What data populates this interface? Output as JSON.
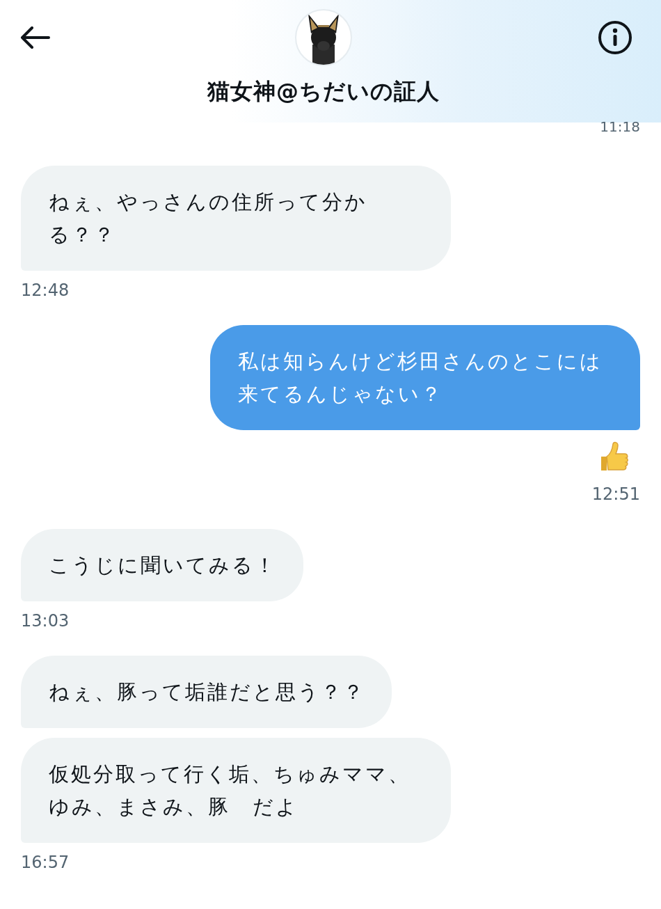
{
  "header": {
    "title": "猫女神@ちだいの証人"
  },
  "top_time": "11:18",
  "messages": [
    {
      "kind": "received",
      "bubbles": [
        "ねぇ、やっさんの住所って分かる？？"
      ],
      "liked": false,
      "time": "12:48"
    },
    {
      "kind": "sent",
      "bubbles": [
        "私は知らんけど杉田さんのとこには来てるんじゃない？"
      ],
      "liked": true,
      "time": "12:51"
    },
    {
      "kind": "received",
      "bubbles": [
        "こうじに聞いてみる！"
      ],
      "liked": false,
      "time": "13:03"
    },
    {
      "kind": "received",
      "bubbles": [
        "ねぇ、豚って垢誰だと思う？？",
        "仮処分取って行く垢、ちゅみママ、ゆみ、まさみ、豚　だよ"
      ],
      "liked": false,
      "time": "16:57"
    }
  ]
}
